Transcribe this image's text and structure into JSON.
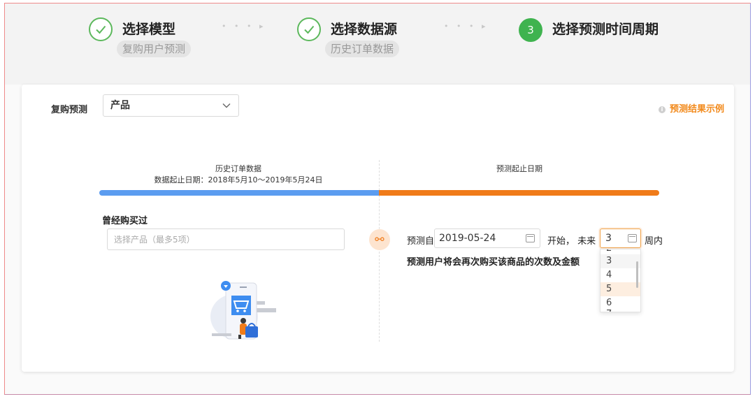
{
  "steps": [
    {
      "title": "选择模型",
      "sub": "复购用户预测",
      "icon": "check-icon"
    },
    {
      "title": "选择数据源",
      "sub": "历史订单数据",
      "icon": "check-icon"
    },
    {
      "number": "3",
      "title": "选择预测时间周期"
    }
  ],
  "step_arrow": "• • • ▸",
  "form": {
    "label": "复购预测",
    "select_value": "产品",
    "example_link": "预测结果示例",
    "example_icon": "info-icon"
  },
  "timeline": {
    "history_title": "历史订单数据",
    "history_range": "数据起止日期：2018年5月10～2019年5月24日",
    "predict_title": "预测起止日期",
    "history_color": "#5b9cf0",
    "predict_color": "#f07b19"
  },
  "left": {
    "label": "曾经购买过",
    "placeholder": "选择产品（最多5项）"
  },
  "right": {
    "from_label": "预测自",
    "date_value": "2019-05-24",
    "begin_label": "开始，",
    "future_label": "未来",
    "weeks_value": "3",
    "weeks_suffix": "周内",
    "description": "预测用户将会再次购买该商品的次数及金额"
  },
  "dropdown": {
    "options": [
      "3",
      "4",
      "5",
      "6"
    ],
    "selected": "3",
    "hovered": "5"
  },
  "colors": {
    "accent": "#f07b19",
    "success": "#3fb34f",
    "link": "#f28a1c"
  }
}
